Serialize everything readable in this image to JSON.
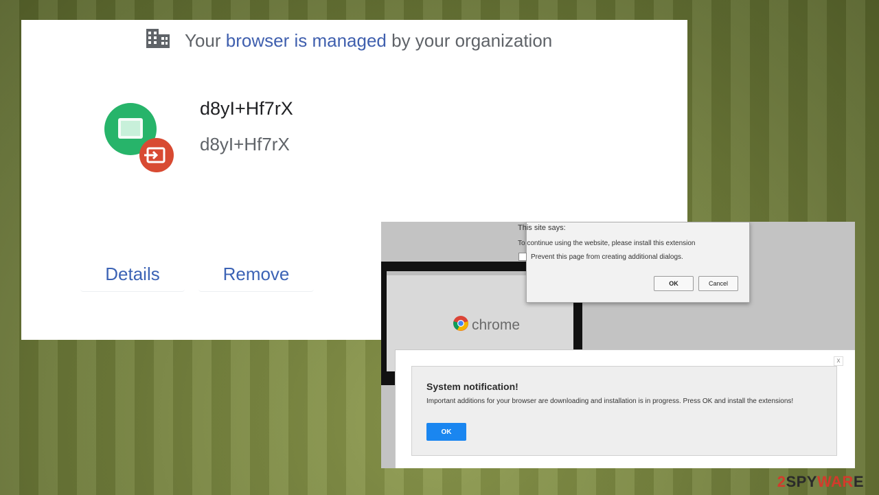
{
  "managed": {
    "header_prefix": "Your ",
    "header_link": "browser is managed",
    "header_suffix": " by your organization",
    "header_icon": "building-icon",
    "extension": {
      "name": "d8yI+Hf7rX",
      "id": "d8yI+Hf7rX",
      "icon": "extension-app-icon",
      "badge_icon": "input-exit-icon",
      "icon_color": "#27b46a",
      "badge_color": "#d84a32"
    },
    "buttons": {
      "details": "Details",
      "remove": "Remove"
    },
    "accent_color": "#3c63b5"
  },
  "scam": {
    "chrome_word": "chrome",
    "confirm": {
      "title": "This site says:",
      "message": "To continue using the website, please install this extension",
      "checkbox_label": "Prevent this page from creating additional dialogs.",
      "ok": "OK",
      "cancel": "Cancel"
    },
    "notification": {
      "close": "x",
      "title": "System notification!",
      "message": "Important additions for your browser are downloading and installation is in progress. Press OK and install the extensions!",
      "ok": "OK",
      "ok_color": "#1a86f0"
    }
  },
  "watermark": {
    "part1": "2",
    "part2": "SPY",
    "part3": "WAR",
    "part4": "E"
  }
}
